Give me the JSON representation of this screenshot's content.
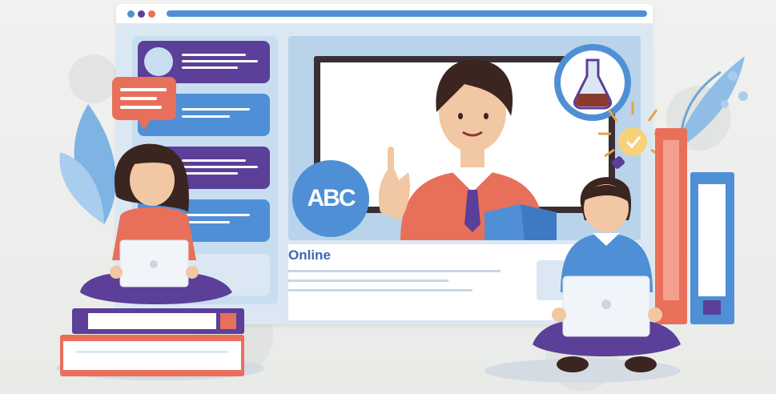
{
  "scene": {
    "title": "Online",
    "badge_text": "ABC",
    "colors": {
      "accent_blue": "#4f8fd6",
      "purple": "#5b3f98",
      "coral": "#e8705a",
      "skin": "#f2c7a3",
      "hair": "#3b2520"
    }
  }
}
